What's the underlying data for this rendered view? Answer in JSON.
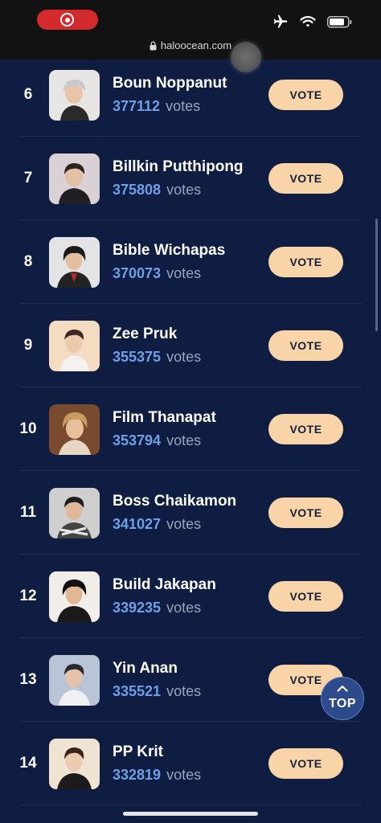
{
  "status_bar": {
    "recording_indicator": "screen-recording-icon",
    "icons": [
      "airplane-icon",
      "wifi-icon",
      "battery-icon"
    ]
  },
  "browser": {
    "url": "haloocean.com",
    "lock_icon": "lock-icon"
  },
  "ranking": [
    {
      "rank": "6",
      "name": "Boun Noppanut",
      "votes": "377112",
      "votes_label": "votes",
      "button": "VOTE"
    },
    {
      "rank": "7",
      "name": "Billkin Putthipong",
      "votes": "375808",
      "votes_label": "votes",
      "button": "VOTE"
    },
    {
      "rank": "8",
      "name": "Bible Wichapas",
      "votes": "370073",
      "votes_label": "votes",
      "button": "VOTE"
    },
    {
      "rank": "9",
      "name": "Zee Pruk",
      "votes": "355375",
      "votes_label": "votes",
      "button": "VOTE"
    },
    {
      "rank": "10",
      "name": "Film Thanapat",
      "votes": "353794",
      "votes_label": "votes",
      "button": "VOTE"
    },
    {
      "rank": "11",
      "name": "Boss Chaikamon",
      "votes": "341027",
      "votes_label": "votes",
      "button": "VOTE"
    },
    {
      "rank": "12",
      "name": "Build Jakapan",
      "votes": "339235",
      "votes_label": "votes",
      "button": "VOTE"
    },
    {
      "rank": "13",
      "name": "Yin Anan",
      "votes": "335521",
      "votes_label": "votes",
      "button": "VOTE"
    },
    {
      "rank": "14",
      "name": "PP Krit",
      "votes": "332819",
      "votes_label": "votes",
      "button": "VOTE"
    }
  ],
  "top_button": {
    "label": "TOP",
    "icon": "chevron-up-icon"
  },
  "colors": {
    "background": "#0f1d42",
    "vote_count": "#6f9fe6",
    "vote_button": "#f8d4a8",
    "top_button": "#2c4a8c",
    "recording": "#d42a2e"
  }
}
